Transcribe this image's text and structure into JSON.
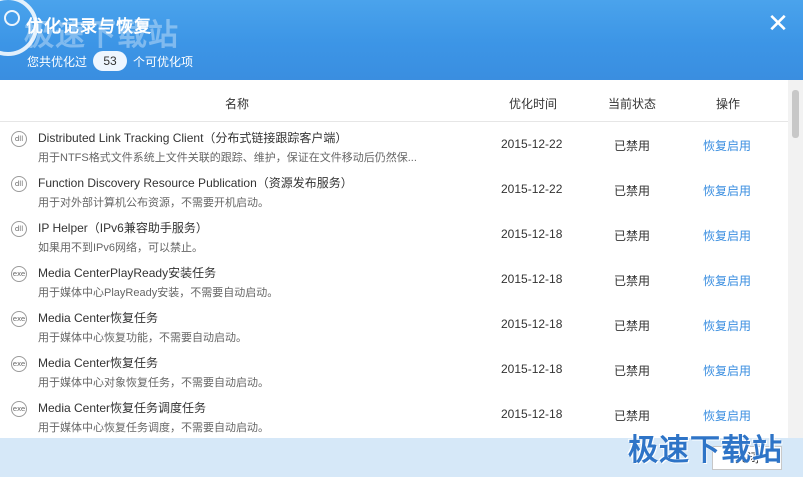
{
  "header": {
    "title": "优化记录与恢复",
    "watermark": "极速下载站",
    "close_glyph": "✕",
    "summary_prefix": "您共优化过",
    "summary_count": "53",
    "summary_suffix": "个可优化项"
  },
  "table": {
    "columns": {
      "name": "名称",
      "time": "优化时间",
      "status": "当前状态",
      "op": "操作"
    },
    "rows": [
      {
        "icon": "dll",
        "name": "Distributed Link Tracking Client（分布式链接跟踪客户端）",
        "desc": "用于NTFS格式文件系统上文件关联的跟踪、维护，保证在文件移动后仍然保...",
        "time": "2015-12-22",
        "status": "已禁用",
        "action": "恢复启用"
      },
      {
        "icon": "dll",
        "name": "Function Discovery Resource Publication（资源发布服务）",
        "desc": "用于对外部计算机公布资源，不需要开机启动。",
        "time": "2015-12-22",
        "status": "已禁用",
        "action": "恢复启用"
      },
      {
        "icon": "dll",
        "name": "IP Helper（IPv6兼容助手服务）",
        "desc": "如果用不到IPv6网络，可以禁止。",
        "time": "2015-12-18",
        "status": "已禁用",
        "action": "恢复启用"
      },
      {
        "icon": "exe",
        "name": "Media CenterPlayReady安装任务",
        "desc": "用于媒体中心PlayReady安装，不需要自动启动。",
        "time": "2015-12-18",
        "status": "已禁用",
        "action": "恢复启用"
      },
      {
        "icon": "exe",
        "name": "Media Center恢复任务",
        "desc": "用于媒体中心恢复功能，不需要自动启动。",
        "time": "2015-12-18",
        "status": "已禁用",
        "action": "恢复启用"
      },
      {
        "icon": "exe",
        "name": "Media Center恢复任务",
        "desc": "用于媒体中心对象恢复任务，不需要自动启动。",
        "time": "2015-12-18",
        "status": "已禁用",
        "action": "恢复启用"
      },
      {
        "icon": "exe",
        "name": "Media Center恢复任务调度任务",
        "desc": "用于媒体中心恢复任务调度，不需要自动启动。",
        "time": "2015-12-18",
        "status": "已禁用",
        "action": "恢复启用"
      }
    ]
  },
  "footer": {
    "button_label": "关闭",
    "watermark": "极速下载站"
  },
  "colors": {
    "header_bg": "#3c95e6",
    "link": "#3a8ee0",
    "footer_bg": "#d6e8f8"
  }
}
